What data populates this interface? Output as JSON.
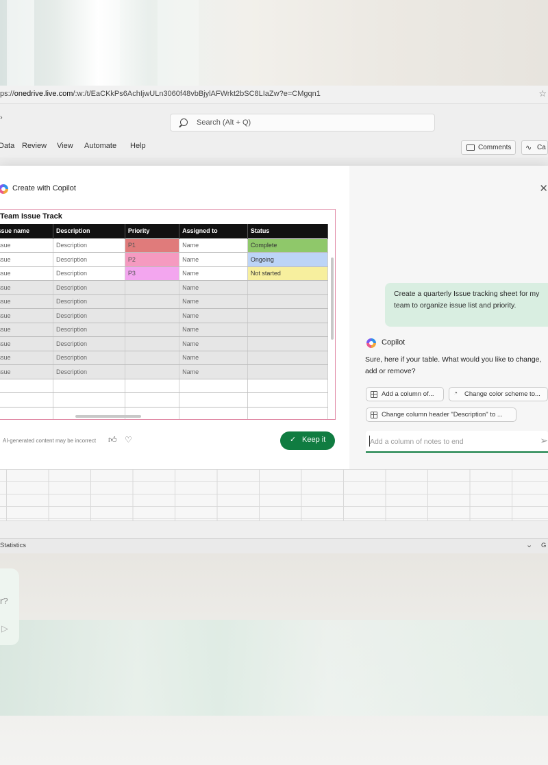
{
  "browser": {
    "url_prefix": "ps://",
    "url_domain": "onedrive.live.com",
    "url_path": "/:w:/t/EaCKkPs6AchIjwULn3060f48vbBjylAFWrkt2bSC8LIaZw?e=CMgqn1"
  },
  "excel": {
    "search_placeholder": "Search (Alt + Q)",
    "ribbon_tabs": [
      "Data",
      "Review",
      "View",
      "Automate",
      "Help"
    ],
    "comments_label": "Comments",
    "catch_up_label": "Ca",
    "status_left": "Statistics",
    "status_right": "G"
  },
  "dialog": {
    "title": "Create with Copilot",
    "table_title": "Team Issue Track",
    "columns": [
      "Issue name",
      "Description",
      "Priority",
      "Assigned to",
      "Status"
    ],
    "rows": [
      [
        "Issue",
        "Description",
        "P1",
        "Name",
        "Complete"
      ],
      [
        "Issue",
        "Description",
        "P2",
        "Name",
        "Ongoing"
      ],
      [
        "Issue",
        "Description",
        "P3",
        "Name",
        "Not started"
      ],
      [
        "Issue",
        "Description",
        "",
        "Name",
        ""
      ],
      [
        "Issue",
        "Description",
        "",
        "Name",
        ""
      ],
      [
        "Issue",
        "Description",
        "",
        "Name",
        ""
      ],
      [
        "Issue",
        "Description",
        "",
        "Name",
        ""
      ],
      [
        "Issue",
        "Description",
        "",
        "Name",
        ""
      ],
      [
        "Issue",
        "Description",
        "",
        "Name",
        ""
      ],
      [
        "Issue",
        "Description",
        "",
        "Name",
        ""
      ]
    ],
    "priority_colors": {
      "P1": "#e07b7b",
      "P2": "#f59ac0",
      "P3": "#f3a6ef"
    },
    "status_colors": {
      "Complete": "#8fc86a",
      "Ongoing": "#bcd4f7",
      "Not started": "#f7ef9e"
    },
    "disclaimer": "AI-generated content may be incorrect",
    "keep_label": "Keep it",
    "chat": {
      "user_message": "Create a quarterly Issue tracking sheet for my team to organize issue list and priority.",
      "assistant_name": "Copilot",
      "assistant_message": "Sure, here if your table. What would you like to change, add or remove?",
      "suggestions": [
        "Add a column of...",
        "Change color scheme to...",
        "Change column header \"Description\" to ..."
      ],
      "input_placeholder": "Add a column of notes to end"
    }
  },
  "reflection": {
    "text": "r?"
  },
  "icons": [
    "star-icon",
    "search-icon",
    "comment-icon",
    "activity-icon",
    "copilot-icon",
    "close-icon",
    "thumbs-up-icon",
    "thumbs-down-icon",
    "check-icon",
    "table-icon",
    "palette-icon",
    "send-icon",
    "chevron-down-icon"
  ],
  "colors": {
    "accent_green": "#107c41",
    "bubble_green": "#d9eee1",
    "preview_border": "#e08aa6"
  }
}
